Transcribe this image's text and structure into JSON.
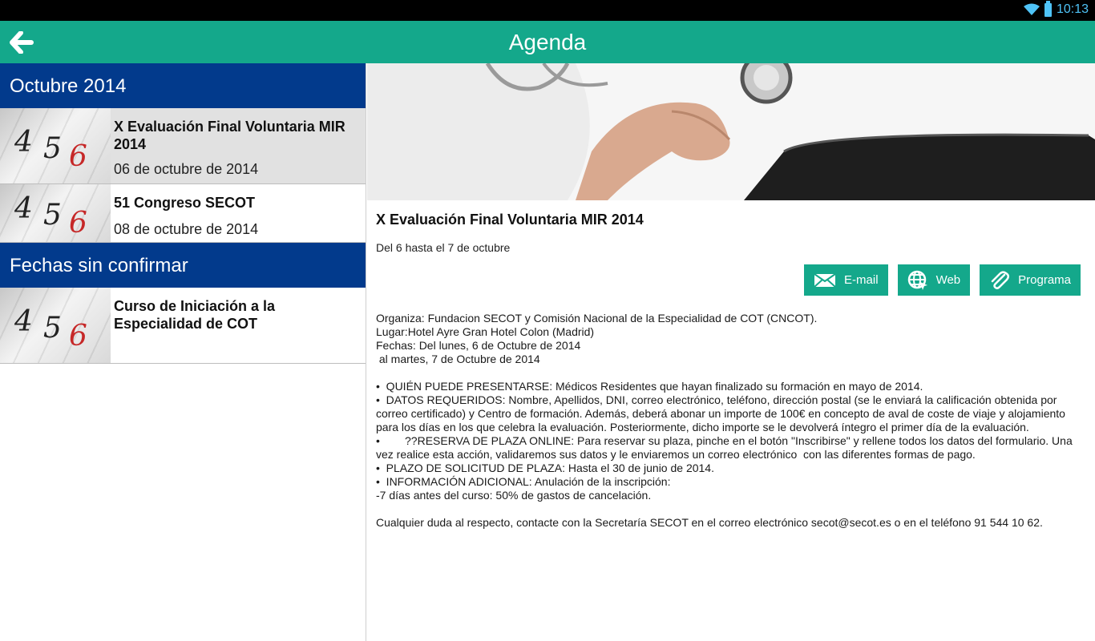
{
  "status": {
    "time": "10:13"
  },
  "appbar": {
    "title": "Agenda"
  },
  "sections": [
    {
      "header": "Octubre 2014",
      "events": [
        {
          "title": "X Evaluación Final Voluntaria MIR 2014",
          "date": "06 de octubre de 2014"
        },
        {
          "title": "51 Congreso SECOT",
          "date": "08 de octubre de 2014"
        }
      ]
    },
    {
      "header": "Fechas sin confirmar",
      "events": [
        {
          "title": "Curso de Iniciación a la Especialidad de COT",
          "date": ""
        }
      ]
    }
  ],
  "thumb_digits": [
    "4",
    "5",
    "6"
  ],
  "detail": {
    "title": "X Evaluación Final Voluntaria MIR 2014",
    "dates": "Del 6 hasta el 7 de octubre",
    "buttons": {
      "email": "E-mail",
      "web": "Web",
      "programa": "Programa"
    },
    "body": [
      "Organiza: Fundacion SECOT y Comisión Nacional de la Especialidad de COT (CNCOT).",
      "Lugar:Hotel Ayre Gran Hotel Colon (Madrid)",
      "Fechas: Del lunes, 6 de Octubre de 2014",
      " al martes, 7 de Octubre de 2014",
      "",
      "•  QUIÉN PUEDE PRESENTARSE: Médicos Residentes que hayan finalizado su formación en mayo de 2014.",
      "•  DATOS REQUERIDOS: Nombre, Apellidos, DNI, correo electrónico, teléfono, dirección postal (se le enviará la calificación obtenida por correo certificado) y Centro de formación. Además, deberá abonar un importe de 100€ en concepto de aval de coste de viaje y alojamiento para los días en los que celebra la evaluación. Posteriormente, dicho importe se le devolverá íntegro el primer día de la evaluación.",
      "•        ??RESERVA DE PLAZA ONLINE: Para reservar su plaza, pinche en el botón \"Inscribirse\" y rellene todos los datos del formulario. Una       vez realice esta acción, validaremos sus datos y le enviaremos un correo electrónico  con las diferentes formas de pago.",
      "•  PLAZO DE SOLICITUD DE PLAZA: Hasta el 30 de junio de 2014.",
      "•  INFORMACIÓN ADICIONAL: Anulación de la inscripción:",
      "-7 días antes del curso: 50% de gastos de cancelación.",
      "",
      "Cualquier duda al respecto, contacte con la Secretaría SECOT en el correo electrónico secot@secot.es o en el teléfono 91 544 10 62."
    ]
  },
  "colors": {
    "appbar": "#14a88b",
    "section_header": "#023a8c",
    "button": "#14a88b"
  }
}
